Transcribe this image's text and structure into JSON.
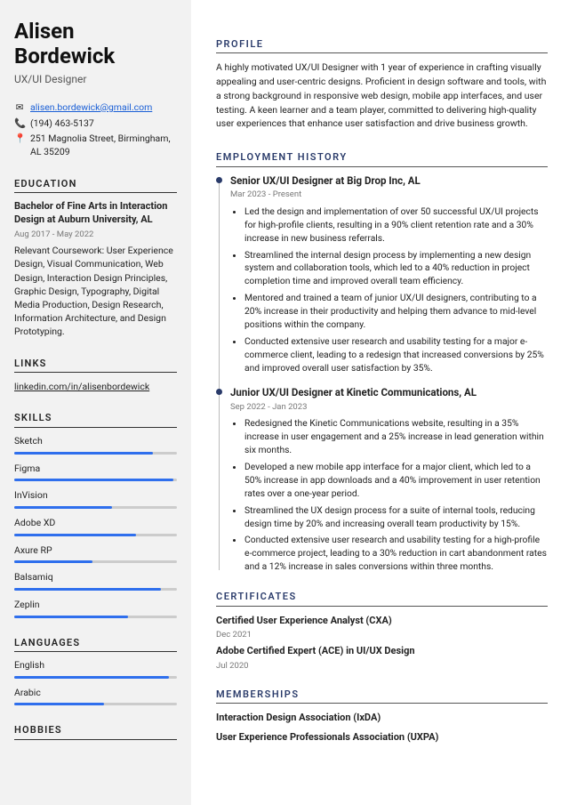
{
  "identity": {
    "first_name": "Alisen",
    "last_name": "Bordewick",
    "title": "UX/UI Designer"
  },
  "contact": {
    "email": "alisen.bordewick@gmail.com",
    "phone": "(194) 463-5137",
    "address": "251 Magnolia Street, Birmingham, AL 35209"
  },
  "education": {
    "heading": "EDUCATION",
    "degree": "Bachelor of Fine Arts in Interaction Design at Auburn University, AL",
    "date": "Aug 2017 - May 2022",
    "details": "Relevant Coursework: User Experience Design, Visual Communication, Web Design, Interaction Design Principles, Graphic Design, Typography, Digital Media Production, Design Research, Information Architecture, and Design Prototyping."
  },
  "links": {
    "heading": "LINKS",
    "items": [
      "linkedin.com/in/alisenbordewick"
    ]
  },
  "skills": {
    "heading": "SKILLS",
    "items": [
      {
        "name": "Sketch",
        "level": 85
      },
      {
        "name": "Figma",
        "level": 98
      },
      {
        "name": "InVision",
        "level": 60
      },
      {
        "name": "Adobe XD",
        "level": 75
      },
      {
        "name": "Axure RP",
        "level": 48
      },
      {
        "name": "Balsamiq",
        "level": 90
      },
      {
        "name": "Zeplin",
        "level": 70
      }
    ]
  },
  "languages": {
    "heading": "LANGUAGES",
    "items": [
      {
        "name": "English",
        "level": 95
      },
      {
        "name": "Arabic",
        "level": 55
      }
    ]
  },
  "hobbies": {
    "heading": "HOBBIES"
  },
  "profile": {
    "heading": "PROFILE",
    "text": "A highly motivated UX/UI Designer with 1 year of experience in crafting visually appealing and user-centric designs. Proficient in design software and tools, with a strong background in responsive web design, mobile app interfaces, and user testing. A keen learner and a team player, committed to delivering high-quality user experiences that enhance user satisfaction and drive business growth."
  },
  "employment": {
    "heading": "EMPLOYMENT HISTORY",
    "jobs": [
      {
        "title": "Senior UX/UI Designer at Big Drop Inc, AL",
        "date": "Mar 2023 - Present",
        "bullets": [
          "Led the design and implementation of over 50 successful UX/UI projects for high-profile clients, resulting in a 90% client retention rate and a 30% increase in new business referrals.",
          "Streamlined the internal design process by implementing a new design system and collaboration tools, which led to a 40% reduction in project completion time and improved overall team efficiency.",
          "Mentored and trained a team of junior UX/UI designers, contributing to a 20% increase in their productivity and helping them advance to mid-level positions within the company.",
          "Conducted extensive user research and usability testing for a major e-commerce client, leading to a redesign that increased conversions by 25% and improved overall user satisfaction by 35%."
        ]
      },
      {
        "title": "Junior UX/UI Designer at Kinetic Communications, AL",
        "date": "Sep 2022 - Jan 2023",
        "bullets": [
          "Redesigned the Kinetic Communications website, resulting in a 35% increase in user engagement and a 25% increase in lead generation within six months.",
          "Developed a new mobile app interface for a major client, which led to a 50% increase in app downloads and a 40% improvement in user retention rates over a one-year period.",
          "Streamlined the UX design process for a suite of internal tools, reducing design time by 20% and increasing overall team productivity by 15%.",
          "Conducted extensive user research and usability testing for a high-profile e-commerce project, leading to a 30% reduction in cart abandonment rates and a 12% increase in sales conversions within three months."
        ]
      }
    ]
  },
  "certificates": {
    "heading": "CERTIFICATES",
    "items": [
      {
        "name": "Certified User Experience Analyst (CXA)",
        "date": "Dec 2021"
      },
      {
        "name": "Adobe Certified Expert (ACE) in UI/UX Design",
        "date": "Jul 2020"
      }
    ]
  },
  "memberships": {
    "heading": "MEMBERSHIPS",
    "items": [
      "Interaction Design Association (IxDA)",
      "User Experience Professionals Association (UXPA)"
    ]
  }
}
